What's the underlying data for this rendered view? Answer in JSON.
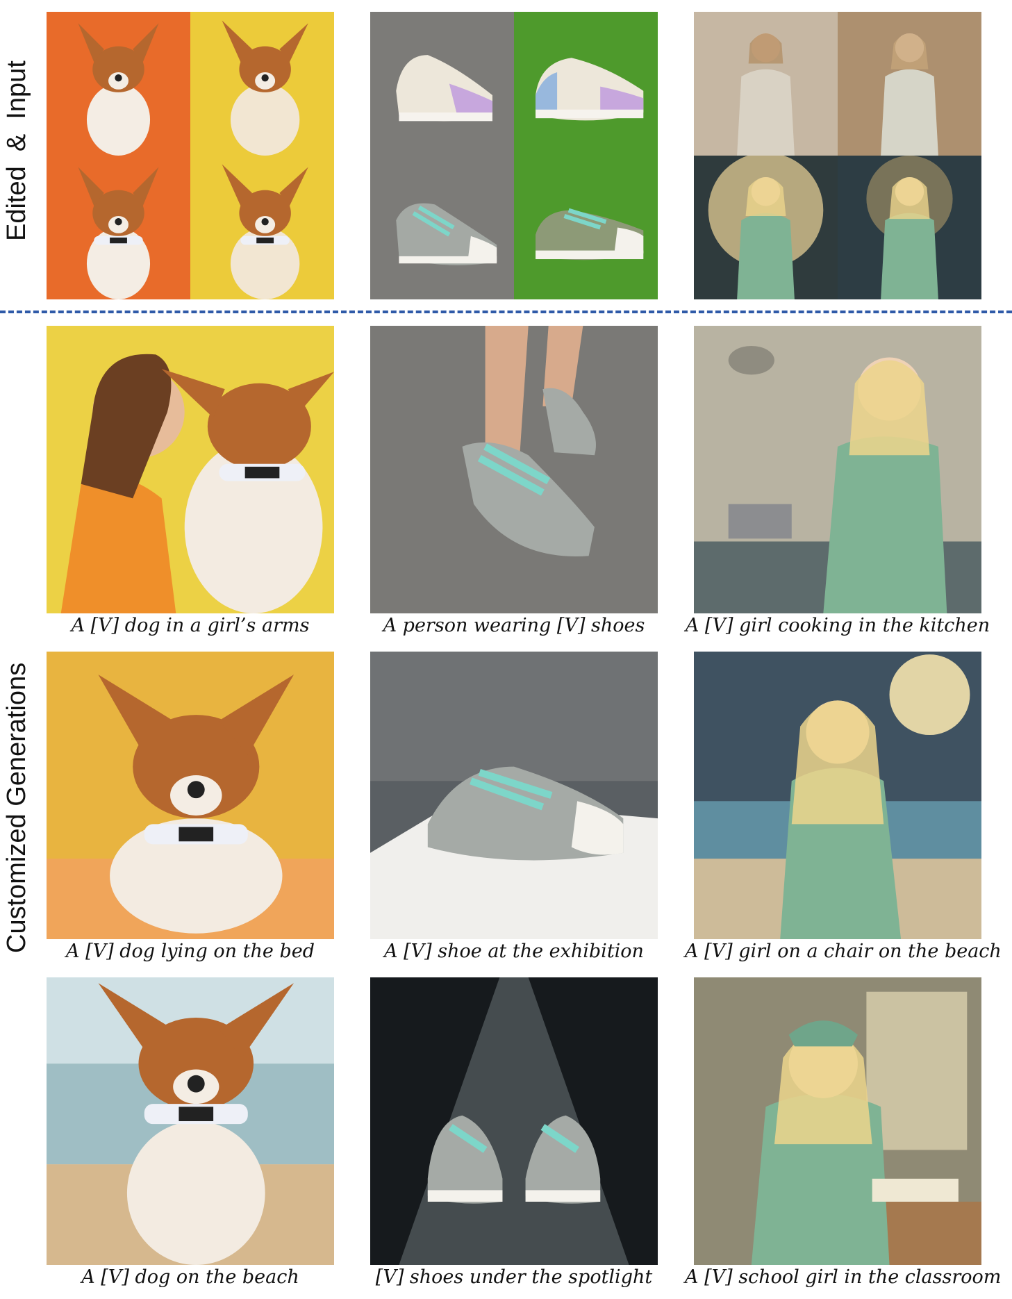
{
  "side_labels": {
    "top": "Edited  &  Input",
    "bottom": "Customized Generations"
  },
  "captions": {
    "dog_arms": "A [V] dog in a girl’s arms",
    "shoes_person": "A person wearing [V] shoes",
    "girl_kitchen": "A [V] girl cooking in the kitchen",
    "dog_bed": "A [V] dog lying on the bed",
    "shoe_exhibition": "A [V] shoe at the exhibition",
    "girl_beach": "A [V] girl on a chair on the beach",
    "dog_beach": "A [V] dog on the beach",
    "shoes_spotlight": "[V] shoes under the spotlight",
    "girl_classroom": "A [V] school girl in the classroom"
  },
  "colors": {
    "divider": "#2f5aa8",
    "orange_bg": "#e86b2a",
    "yellow_bg": "#eccb3a",
    "asphalt": "#7c7b78",
    "grass": "#4e9a2c",
    "elf_dress": "#7fb394"
  }
}
